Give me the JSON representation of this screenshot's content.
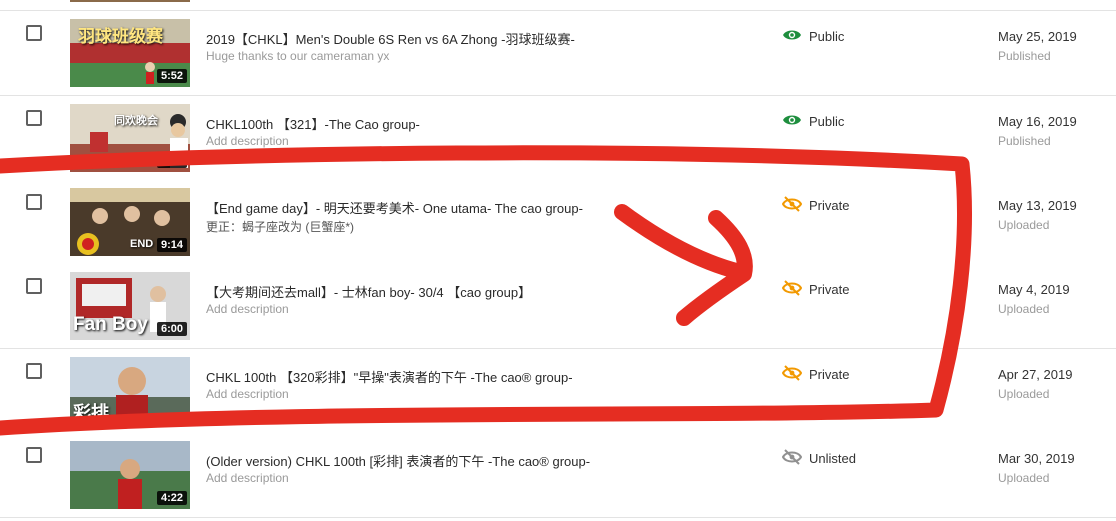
{
  "colors": {
    "public_icon": "#1e8e3e",
    "private_icon": "#f29900",
    "unlisted_icon": "#909090",
    "annotation": "#e52d22"
  },
  "rows": [
    {
      "title": "2019【CHKL】Men's Double 6S Ren vs 6A Zhong -羽球班级赛-",
      "description": "Huge thanks to our cameraman yx",
      "duration": "5:52",
      "thumb_text": "羽球班级赛",
      "visibility": "Public",
      "visibility_icon": "eye-icon",
      "date": "May 25, 2019",
      "status": "Published"
    },
    {
      "title": "CHKL100th 【321】-The Cao group-",
      "description": "Add description",
      "duration": "7:58",
      "thumb_text": "同欢晚会",
      "visibility": "Public",
      "visibility_icon": "eye-icon",
      "date": "May 16, 2019",
      "status": "Published"
    },
    {
      "title": "【End game day】- 明天还要考美术- One utama- The cao group-",
      "description": "更正：蝎子座改为 (巨蟹座*)",
      "duration": "9:14",
      "thumb_text": "END",
      "visibility": "Private",
      "visibility_icon": "eye-off-icon",
      "date": "May 13, 2019",
      "status": "Uploaded"
    },
    {
      "title": "【大考期间还去mall】- 士林fan boy- 30/4 【cao group】",
      "description": "Add description",
      "duration": "6:00",
      "thumb_text": "Fan Boy",
      "visibility": "Private",
      "visibility_icon": "eye-off-icon",
      "date": "May 4, 2019",
      "status": "Uploaded"
    },
    {
      "title": "CHKL 100th 【320彩排】\"早操\"表演者的下午 -The cao® group-",
      "description": "Add description",
      "duration": "",
      "thumb_text": "彩排",
      "visibility": "Private",
      "visibility_icon": "eye-off-icon",
      "date": "Apr 27, 2019",
      "status": "Uploaded"
    },
    {
      "title": "(Older version) CHKL 100th [彩排] 表演者的下午 -The cao® group-",
      "description": "Add description",
      "duration": "4:22",
      "thumb_text": "",
      "visibility": "Unlisted",
      "visibility_icon": "eye-off-icon",
      "date": "Mar 30, 2019",
      "status": "Uploaded"
    }
  ]
}
